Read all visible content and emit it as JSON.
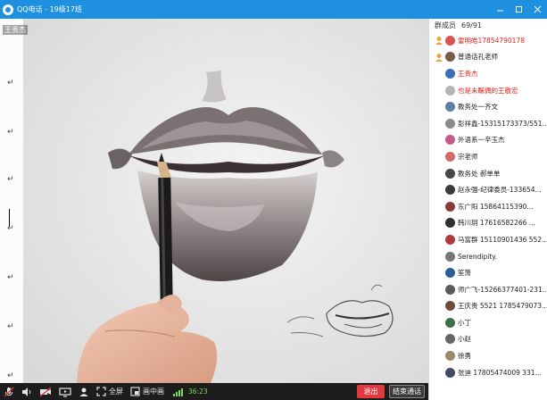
{
  "window": {
    "title": "QQ电话 - 19级17班",
    "controls": [
      "minimize",
      "maximize",
      "close"
    ]
  },
  "video": {
    "speaker_tag": "王贵杰",
    "paragraph_mark": "↵"
  },
  "panel": {
    "header_label": "群成员",
    "member_count": "69/91",
    "members": [
      {
        "name": "雷明皓17854790178",
        "red": true,
        "badge": "host-icon",
        "avatar": "#d9534f"
      },
      {
        "name": "普通话孔老师",
        "red": false,
        "badge": "host-icon",
        "avatar": "#7a5a4a"
      },
      {
        "name": "王贵杰",
        "red": true,
        "badge": "",
        "avatar": "#3a6fb5"
      },
      {
        "name": "也是未瞩偶的王敬宏",
        "red": true,
        "badge": "",
        "avatar": "#b5b5b5"
      },
      {
        "name": "教务处一齐文",
        "red": false,
        "badge": "",
        "avatar": "#5c7fa8"
      },
      {
        "name": "彭祥鑫-15315173373/551...",
        "red": false,
        "badge": "",
        "avatar": "#8a8a8a"
      },
      {
        "name": "外语系一辛玉杰",
        "red": false,
        "badge": "",
        "avatar": "#c65a8a"
      },
      {
        "name": "宗老师",
        "red": false,
        "badge": "",
        "avatar": "#d46a6a"
      },
      {
        "name": "教务处  郝单单",
        "red": false,
        "badge": "",
        "avatar": "#444444"
      },
      {
        "name": "赵永强-纪律委员-133654...",
        "red": false,
        "badge": "",
        "avatar": "#3b3b3b"
      },
      {
        "name": "东广阳    15864115390...",
        "red": false,
        "badge": "",
        "avatar": "#8b3a3a"
      },
      {
        "name": "韩川玥   17616582266   ...",
        "red": false,
        "badge": "",
        "avatar": "#2f2f2f"
      },
      {
        "name": "马富群  15110901436  552...",
        "red": false,
        "badge": "",
        "avatar": "#b03a3a"
      },
      {
        "name": "Serendipity.",
        "red": false,
        "badge": "",
        "avatar": "#777777"
      },
      {
        "name": "笙箫",
        "red": false,
        "badge": "",
        "avatar": "#2a5d9e"
      },
      {
        "name": "师广飞-15266377401-231...",
        "red": false,
        "badge": "",
        "avatar": "#5a5a5a"
      },
      {
        "name": "王庆贵  5521  1785479073...",
        "red": false,
        "badge": "",
        "avatar": "#6d4c3d"
      },
      {
        "name": "小丁",
        "red": false,
        "badge": "",
        "avatar": "#3d6f4a"
      },
      {
        "name": "小赵",
        "red": false,
        "badge": "",
        "avatar": "#666666"
      },
      {
        "name": "徐勇",
        "red": false,
        "badge": "",
        "avatar": "#9a8a6a"
      },
      {
        "name": "张迪    17805474009    331...",
        "red": false,
        "badge": "",
        "avatar": "#444a66"
      }
    ]
  },
  "toolbar": {
    "fullscreen_label": "全屏",
    "pip_label": "画中画",
    "timer": "36:23",
    "exit_label": "退出",
    "end_label": "结束通话"
  },
  "colors": {
    "titlebar": "#1f8fe0",
    "exit": "#e0393e",
    "name_red": "#e0261b",
    "timer": "#7ed957"
  }
}
